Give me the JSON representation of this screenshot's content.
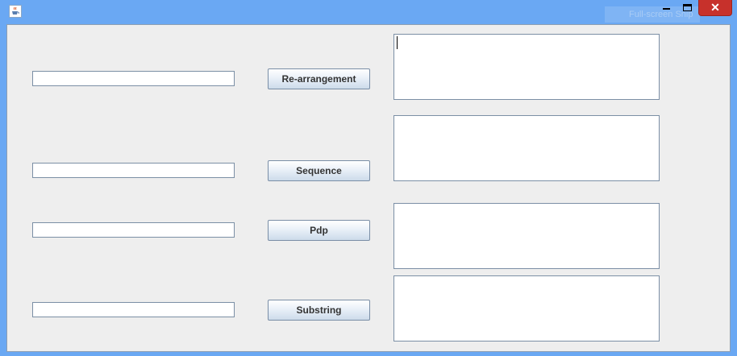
{
  "window": {
    "title": "",
    "behind_label": "Full-screen Snip",
    "controls": {
      "minimize": "minimize",
      "maximize": "maximize",
      "close": "✕"
    }
  },
  "rows": [
    {
      "input_value": "",
      "button_label": "Re-arrangement",
      "output_value": ""
    },
    {
      "input_value": "",
      "button_label": "Sequence",
      "output_value": ""
    },
    {
      "input_value": "",
      "button_label": "Pdp",
      "output_value": ""
    },
    {
      "input_value": "",
      "button_label": "Substring",
      "output_value": ""
    }
  ],
  "icons": {
    "app": "java-cup-icon"
  }
}
